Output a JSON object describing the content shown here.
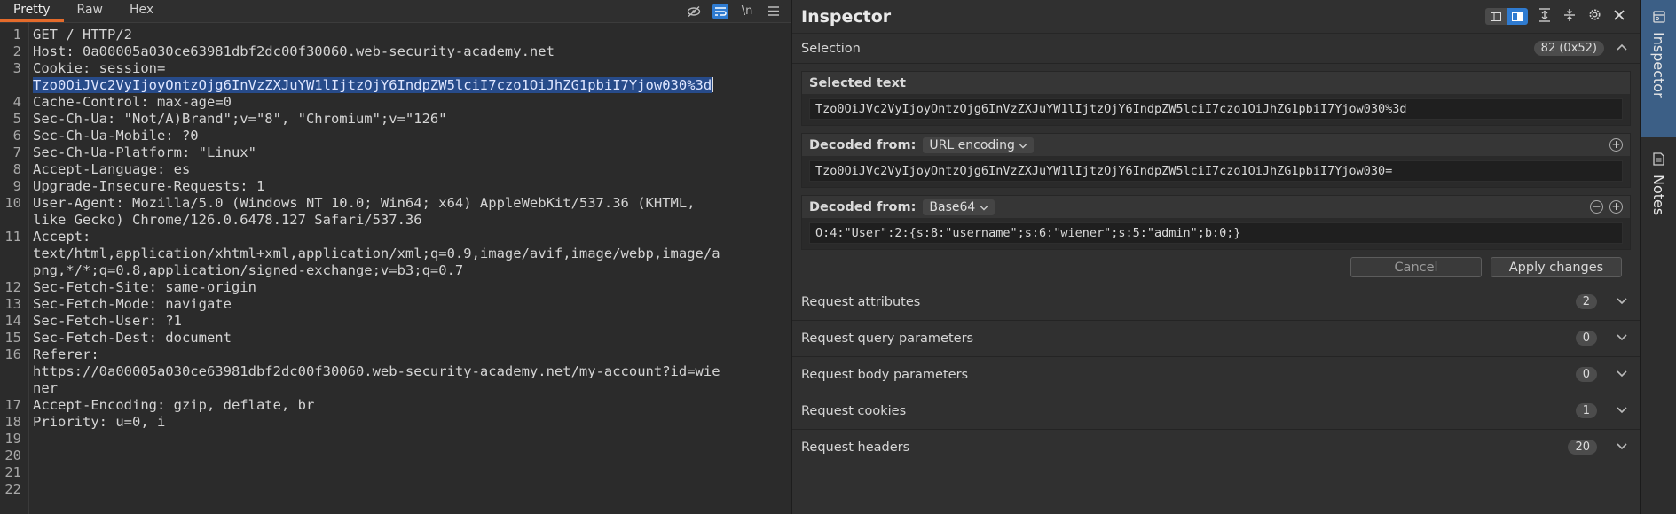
{
  "editor": {
    "tabs": [
      "Pretty",
      "Raw",
      "Hex"
    ],
    "active_tab": "Pretty",
    "tools": [
      "hide-nonprinting-icon",
      "wrap-lines-icon",
      "newline-icon",
      "menu-icon"
    ],
    "newline_label": "\\n",
    "lines": [
      {
        "n": "1",
        "text": "GET / HTTP/2"
      },
      {
        "n": "2",
        "text": "Host: 0a00005a030ce63981dbf2dc00f30060.web-security-academy.net"
      },
      {
        "n": "3",
        "text": "Cookie: session="
      },
      {
        "n": "",
        "text": "Tzo0OiJVc2VyIjoyOntzOjg6InVzZXJuYW1lIjtzOjY6IndpZW5lciI7czo1OiJhZG1pbiI7Yjow030%3d",
        "selected": true
      },
      {
        "n": "4",
        "text": "Cache-Control: max-age=0"
      },
      {
        "n": "5",
        "text": "Sec-Ch-Ua: \"Not/A)Brand\";v=\"8\", \"Chromium\";v=\"126\""
      },
      {
        "n": "6",
        "text": "Sec-Ch-Ua-Mobile: ?0"
      },
      {
        "n": "7",
        "text": "Sec-Ch-Ua-Platform: \"Linux\""
      },
      {
        "n": "8",
        "text": "Accept-Language: es"
      },
      {
        "n": "9",
        "text": "Upgrade-Insecure-Requests: 1"
      },
      {
        "n": "10",
        "text": "User-Agent: Mozilla/5.0 (Windows NT 10.0; Win64; x64) AppleWebKit/537.36 (KHTML,"
      },
      {
        "n": "",
        "text": "like Gecko) Chrome/126.0.6478.127 Safari/537.36"
      },
      {
        "n": "11",
        "text": "Accept:"
      },
      {
        "n": "",
        "text": "text/html,application/xhtml+xml,application/xml;q=0.9,image/avif,image/webp,image/a"
      },
      {
        "n": "",
        "text": "png,*/*;q=0.8,application/signed-exchange;v=b3;q=0.7"
      },
      {
        "n": "12",
        "text": "Sec-Fetch-Site: same-origin"
      },
      {
        "n": "13",
        "text": "Sec-Fetch-Mode: navigate"
      },
      {
        "n": "14",
        "text": "Sec-Fetch-User: ?1"
      },
      {
        "n": "15",
        "text": "Sec-Fetch-Dest: document"
      },
      {
        "n": "16",
        "text": "Referer:"
      },
      {
        "n": "",
        "text": "https://0a00005a030ce63981dbf2dc00f30060.web-security-academy.net/my-account?id=wie"
      },
      {
        "n": "",
        "text": "ner"
      },
      {
        "n": "17",
        "text": "Accept-Encoding: gzip, deflate, br"
      },
      {
        "n": "18",
        "text": "Priority: u=0, i"
      },
      {
        "n": "19",
        "text": ""
      },
      {
        "n": "20",
        "text": ""
      },
      {
        "n": "21",
        "text": ""
      },
      {
        "n": "22",
        "text": ""
      }
    ]
  },
  "inspector": {
    "title": "Inspector",
    "tools": [
      "layout-list-icon",
      "layout-split-icon",
      "expand-all-icon",
      "collapse-all-icon",
      "settings-icon",
      "close-icon"
    ],
    "selection": {
      "label": "Selection",
      "badge": "82 (0x52)",
      "selected_text_label": "Selected text",
      "selected_text": "Tzo0OiJVc2VyIjoyOntzOjg6InVzZXJuYW1lIjtzOjY6IndpZW5lciI7czo1OiJhZG1pbiI7Yjow030%3d",
      "decoded_from_label": "Decoded from:",
      "decode1_type": "URL encoding",
      "decode1_value": "Tzo0OiJVc2VyIjoyOntzOjg6InVzZXJuYW1lIjtzOjY6IndpZW5lciI7czo1OiJhZG1pbiI7Yjow030=",
      "decode2_type": "Base64",
      "decode2_value": "O:4:\"User\":2:{s:8:\"username\";s:6:\"wiener\";s:5:\"admin\";b:0;}",
      "cancel_label": "Cancel",
      "apply_label": "Apply changes"
    },
    "sections": [
      {
        "label": "Request attributes",
        "count": "2"
      },
      {
        "label": "Request query parameters",
        "count": "0"
      },
      {
        "label": "Request body parameters",
        "count": "0"
      },
      {
        "label": "Request cookies",
        "count": "1"
      },
      {
        "label": "Request headers",
        "count": "20"
      }
    ]
  },
  "side_tabs": [
    {
      "label": "Inspector",
      "icon": "inspector-icon",
      "active": true
    },
    {
      "label": "Notes",
      "icon": "notes-icon",
      "active": false
    }
  ],
  "colors": {
    "accent_orange": "#e46b2b",
    "accent_blue": "#2f7bd0",
    "selection": "#274b8a"
  }
}
